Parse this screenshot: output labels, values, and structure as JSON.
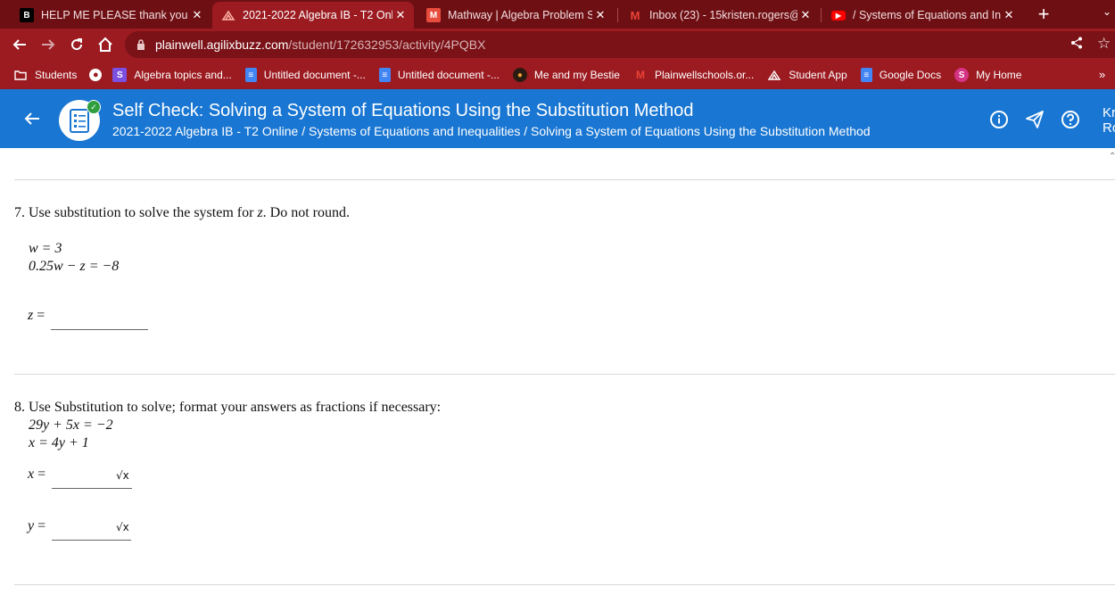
{
  "browser": {
    "tabs": [
      {
        "title": "HELP ME PLEASE thank you - I",
        "icon": "brainly-icon",
        "active": false
      },
      {
        "title": "2021-2022 Algebra IB - T2 Onl",
        "icon": "agilix-icon",
        "active": true
      },
      {
        "title": "Mathway | Algebra Problem So",
        "icon": "mathway-icon",
        "active": false
      },
      {
        "title": "Inbox (23) - 15kristen.rogers@",
        "icon": "gmail-icon",
        "active": false
      },
      {
        "title": "/ Systems of Equations and In",
        "icon": "youtube-icon",
        "active": false
      }
    ],
    "url_host": "plainwell.agilixbuzz.com",
    "url_path": "/student/172632953/activity/4PQBX",
    "bookmarks": [
      {
        "label": "Students",
        "icon": "folder-icon"
      },
      {
        "label": "",
        "icon": "globe-icon"
      },
      {
        "label": "Algebra topics and...",
        "icon": "s-logo-icon"
      },
      {
        "label": "Untitled document -...",
        "icon": "docs-icon"
      },
      {
        "label": "Untitled document -...",
        "icon": "docs-icon"
      },
      {
        "label": "Me and my Bestie",
        "icon": "avatar-icon"
      },
      {
        "label": "Plainwellschools.or...",
        "icon": "gmail-icon"
      },
      {
        "label": "Student App",
        "icon": "agilix-icon"
      },
      {
        "label": "Google Docs",
        "icon": "docs-icon"
      },
      {
        "label": "My Home",
        "icon": "s-logo-icon"
      }
    ],
    "overflow_label": "»"
  },
  "header": {
    "title": "Self Check: Solving a System of Equations Using the Substitution Method",
    "breadcrumb": "2021-2022 Algebra IB - T2 Online / Systems of Equations and Inequalities / Solving a System of Equations Using the Substitution Method",
    "user_line1": "Kr",
    "user_line2": "Ro"
  },
  "questions": [
    {
      "number": "7.",
      "prompt_pre": "Use substitution to solve the system for ",
      "prompt_var": "z",
      "prompt_post": ". Do not round.",
      "equations": [
        "w = 3",
        "0.25w − z = −8"
      ],
      "answers": [
        {
          "var": "z",
          "value": ""
        }
      ]
    },
    {
      "number": "8.",
      "prompt": "Use Substitution to solve; format your answers as fractions if necessary:",
      "equations": [
        "29y + 5x = −2",
        "x = 4y + 1"
      ],
      "answers": [
        {
          "var": "x",
          "value": ""
        },
        {
          "var": "y",
          "value": ""
        }
      ]
    }
  ],
  "equals": "=",
  "sqrt_label": "√x"
}
